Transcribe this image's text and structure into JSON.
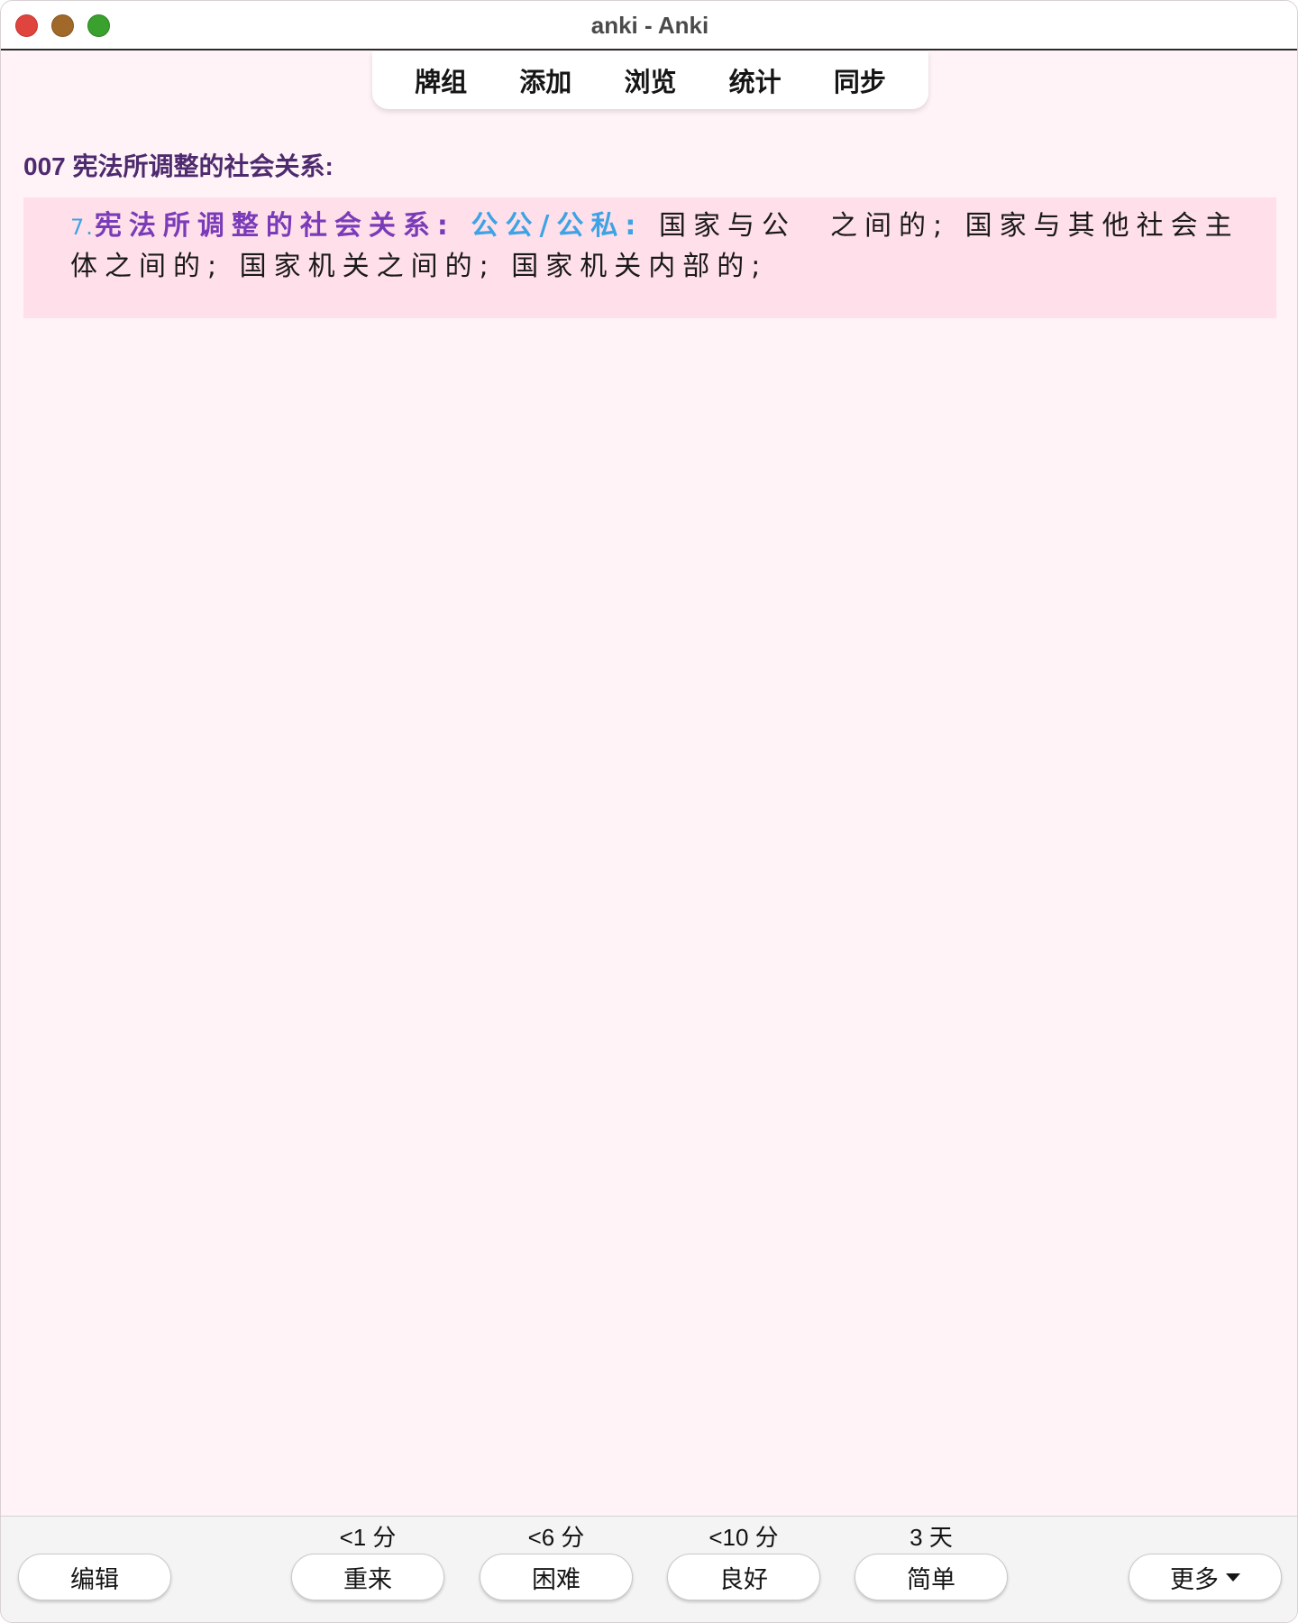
{
  "window": {
    "title": "anki - Anki"
  },
  "topnav": {
    "items": [
      "牌组",
      "添加",
      "浏览",
      "统计",
      "同步"
    ]
  },
  "card": {
    "title": "007 宪法所调整的社会关系:",
    "number": "7.",
    "heading": "宪法所调整的社会关系:",
    "keyword": "公公/公私:",
    "line1_rest": "国家与公　之间的; 国家与其他社会主",
    "line2": "体之间的; 国家机关之间的; 国家机关内部的;"
  },
  "bottom": {
    "edit_label": "编辑",
    "answers": [
      {
        "due": "<1 分",
        "label": "重来"
      },
      {
        "due": "<6 分",
        "label": "困难"
      },
      {
        "due": "<10 分",
        "label": "良好"
      },
      {
        "due": "3 天",
        "label": "简单"
      }
    ],
    "more_label": "更多"
  },
  "colors": {
    "background": "#fff3f7",
    "card_box": "#ffe0ea",
    "card_title": "#4e2a6e",
    "heading_purple": "#7a3bb8",
    "keyword_blue": "#3ea3e4"
  },
  "icons": [
    "close-window-icon",
    "minimize-window-icon",
    "maximize-window-icon",
    "dropdown-caret-icon"
  ]
}
